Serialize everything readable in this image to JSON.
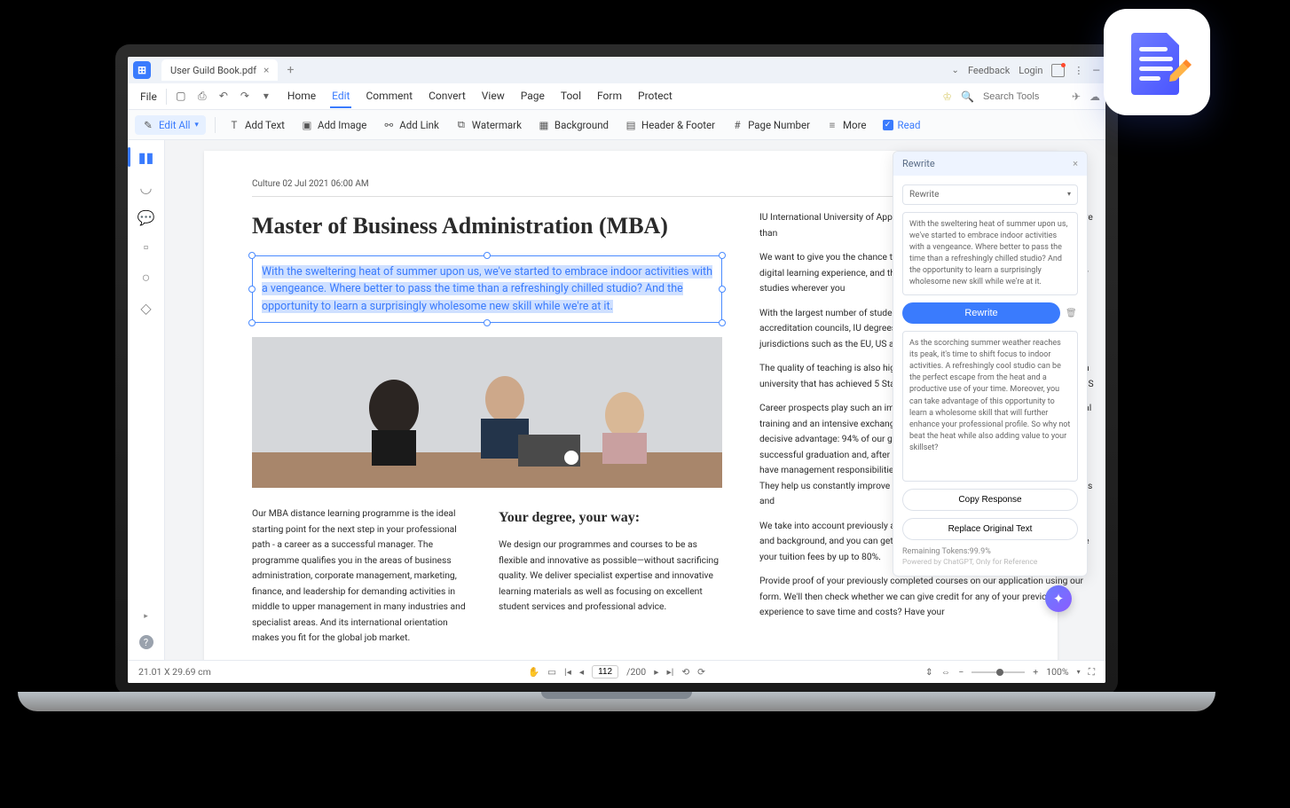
{
  "title_bar": {
    "tab_title": "User Guild Book.pdf",
    "chevron": "⌄",
    "feedback": "Feedback",
    "login": "Login"
  },
  "menu": {
    "file": "File",
    "tabs": [
      "Home",
      "Edit",
      "Comment",
      "Convert",
      "View",
      "Page",
      "Tool",
      "Form",
      "Protect"
    ],
    "active": "Edit",
    "search_placeholder": "Search Tools"
  },
  "toolbar": {
    "edit_all": "Edit All",
    "add_text": "Add Text",
    "add_image": "Add Image",
    "add_link": "Add Link",
    "watermark": "Watermark",
    "background": "Background",
    "header_footer": "Header & Footer",
    "page_number": "Page Number",
    "more": "More",
    "read": "Read"
  },
  "document": {
    "meta": "Culture 02 Jul 2021 06:00 AM",
    "title": "Master of Business Administration (MBA)",
    "selected": "With the sweltering heat of summer upon us, we've started to embrace indoor activities with a vengeance. Where better to pass the time than a refreshingly chilled studio? And the opportunity to learn a surprisingly wholesome new skill while we're at it.",
    "col1": "Our MBA distance learning programme is the ideal starting point for the next step in your professional path - a career as a successful manager. The programme qualifies you in the areas of business administration, corporate management, marketing, finance, and leadership for demanding activities in middle to upper management in many industries and specialist areas. And its international orientation makes you fit for the global job market.",
    "col2_h": "Your degree, your way:",
    "col2": "We design our programmes and courses to be as flexible and innovative as possible—without sacrificing quality. We deliver specialist expertise and innovative learning materials as well as focusing on excellent student services and professional advice.",
    "right_paras": [
      "IU International University of Applied Sciences (IU) is a private university with more than",
      "We want to give you the chance to benefit from our award-winning, innovative digital learning experience, and the flexibility that it brings so you can access your studies wherever you",
      "With the largest number of students of any German university from German state accreditation councils, IU degrees are internationally recognised in many jurisdictions such as the EU, US and",
      "The quality of teaching is also highly regarded. For example, IU is the first German university that has achieved 5 Stars on the prestigious QS Stars education from QS",
      "Career prospects play such an important role in this regard. The focus on practical training and an intensive exchange with experts from the field gives IU students a decisive advantage: 94% of our graduates have a job within three months of successful graduation and, after an average of two years on the job, 80% of them have management responsibilities. Plus, we work closely with big businesses. They help us constantly improve our programmes and give you great opportunities and",
      "We take into account previously acquired skills regardless of location, motivation, and background, and you can get credit for previous experience, which will reduce your tuition fees by up to 80%.",
      "Provide proof of your previously completed courses on our application using our form. We'll then check whether we can give credit for any of your previous experience to save time and costs? Have your"
    ]
  },
  "ai": {
    "title": "Rewrite",
    "mode": "Rewrite",
    "input": "With the sweltering heat of summer upon us, we've started to embrace indoor activities with a vengeance. Where better to pass the time than a refreshingly chilled studio? And the opportunity to learn a surprisingly wholesome new skill while we're at it.",
    "button": "Rewrite",
    "output": "As the scorching summer weather reaches its peak, it's time to shift focus to indoor activities. A refreshingly cool studio can be the perfect escape from the heat and a productive use of your time. Moreover, you can take advantage of this opportunity to learn a wholesome skill that will further enhance your professional profile. So why not beat the heat while also adding value to your skillset?",
    "copy": "Copy Response",
    "replace": "Replace Original Text",
    "tokens": "Remaining Tokens:99.9%",
    "powered": "Powered by ChatGPT, Only for Reference"
  },
  "statusbar": {
    "dims": "21.01 X 29.69 cm",
    "page_current": "112",
    "page_total": "/200",
    "zoom": "100%"
  }
}
